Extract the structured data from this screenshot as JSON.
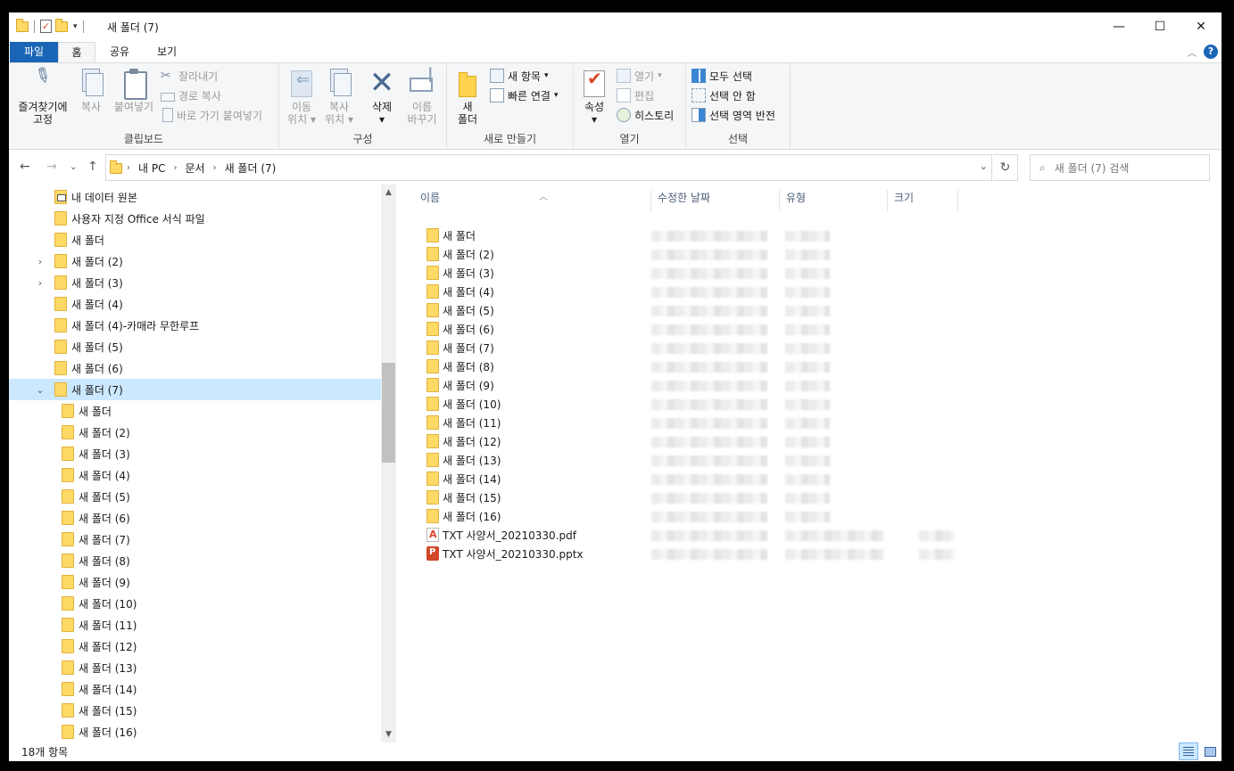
{
  "window": {
    "title": "새 폴더 (7)"
  },
  "tabs": {
    "file": "파일",
    "home": "홈",
    "share": "공유",
    "view": "보기"
  },
  "ribbon": {
    "clipboard": {
      "label": "클립보드",
      "pin_l1": "즐겨찾기에",
      "pin_l2": "고정",
      "copy": "복사",
      "paste": "붙여넣기",
      "cut": "잘라내기",
      "copy_path": "경로 복사",
      "paste_shortcut": "바로 가기 붙여넣기"
    },
    "organize": {
      "label": "구성",
      "move_l1": "이동",
      "move_l2": "위치",
      "copy_l1": "복사",
      "copy_l2": "위치",
      "delete": "삭제",
      "rename_l1": "이름",
      "rename_l2": "바꾸기"
    },
    "new": {
      "label": "새로 만들기",
      "folder_l1": "새",
      "folder_l2": "폴더",
      "new_item": "새 항목",
      "easy_access": "빠른 연결"
    },
    "open": {
      "label": "열기",
      "properties": "속성",
      "open": "열기",
      "edit": "편집",
      "history": "히스토리"
    },
    "select": {
      "label": "선택",
      "select_all": "모두 선택",
      "select_none": "선택 안 함",
      "invert": "선택 영역 반전"
    }
  },
  "address": {
    "crumbs": [
      "내 PC",
      "문서",
      "새 폴더 (7)"
    ],
    "search_placeholder": "새 폴더 (7) 검색"
  },
  "nav_tree": [
    {
      "label": "내 데이터 원본",
      "level": 0,
      "expander": "",
      "special": true
    },
    {
      "label": "사용자 지정 Office 서식 파일",
      "level": 0,
      "expander": ""
    },
    {
      "label": "새 폴더",
      "level": 0,
      "expander": ""
    },
    {
      "label": "새 폴더 (2)",
      "level": 0,
      "expander": "›"
    },
    {
      "label": "새 폴더 (3)",
      "level": 0,
      "expander": "›"
    },
    {
      "label": "새 폴더 (4)",
      "level": 0,
      "expander": ""
    },
    {
      "label": "새 폴더 (4)-카매라 무한루프",
      "level": 0,
      "expander": ""
    },
    {
      "label": "새 폴더 (5)",
      "level": 0,
      "expander": ""
    },
    {
      "label": "새 폴더 (6)",
      "level": 0,
      "expander": ""
    },
    {
      "label": "새 폴더 (7)",
      "level": 0,
      "expander": "⌄",
      "selected": true
    },
    {
      "label": "새 폴더",
      "level": 1,
      "expander": ""
    },
    {
      "label": "새 폴더 (2)",
      "level": 1,
      "expander": ""
    },
    {
      "label": "새 폴더 (3)",
      "level": 1,
      "expander": ""
    },
    {
      "label": "새 폴더 (4)",
      "level": 1,
      "expander": ""
    },
    {
      "label": "새 폴더 (5)",
      "level": 1,
      "expander": ""
    },
    {
      "label": "새 폴더 (6)",
      "level": 1,
      "expander": ""
    },
    {
      "label": "새 폴더 (7)",
      "level": 1,
      "expander": ""
    },
    {
      "label": "새 폴더 (8)",
      "level": 1,
      "expander": ""
    },
    {
      "label": "새 폴더 (9)",
      "level": 1,
      "expander": ""
    },
    {
      "label": "새 폴더 (10)",
      "level": 1,
      "expander": ""
    },
    {
      "label": "새 폴더 (11)",
      "level": 1,
      "expander": ""
    },
    {
      "label": "새 폴더 (12)",
      "level": 1,
      "expander": ""
    },
    {
      "label": "새 폴더 (13)",
      "level": 1,
      "expander": ""
    },
    {
      "label": "새 폴더 (14)",
      "level": 1,
      "expander": ""
    },
    {
      "label": "새 폴더 (15)",
      "level": 1,
      "expander": ""
    },
    {
      "label": "새 폴더 (16)",
      "level": 1,
      "expander": ""
    }
  ],
  "columns": {
    "name": "이름",
    "date": "수정한 날짜",
    "type": "유형",
    "size": "크기"
  },
  "files": [
    {
      "name": "새 폴더",
      "kind": "folder"
    },
    {
      "name": "새 폴더 (2)",
      "kind": "folder"
    },
    {
      "name": "새 폴더 (3)",
      "kind": "folder"
    },
    {
      "name": "새 폴더 (4)",
      "kind": "folder"
    },
    {
      "name": "새 폴더 (5)",
      "kind": "folder"
    },
    {
      "name": "새 폴더 (6)",
      "kind": "folder"
    },
    {
      "name": "새 폴더 (7)",
      "kind": "folder"
    },
    {
      "name": "새 폴더 (8)",
      "kind": "folder"
    },
    {
      "name": "새 폴더 (9)",
      "kind": "folder"
    },
    {
      "name": "새 폴더 (10)",
      "kind": "folder"
    },
    {
      "name": "새 폴더 (11)",
      "kind": "folder"
    },
    {
      "name": "새 폴더 (12)",
      "kind": "folder"
    },
    {
      "name": "새 폴더 (13)",
      "kind": "folder"
    },
    {
      "name": "새 폴더 (14)",
      "kind": "folder"
    },
    {
      "name": "새 폴더 (15)",
      "kind": "folder"
    },
    {
      "name": "새 폴더 (16)",
      "kind": "folder"
    },
    {
      "name": "TXT 사양서_20210330.pdf",
      "kind": "pdf"
    },
    {
      "name": "TXT 사양서_20210330.pptx",
      "kind": "pptx"
    }
  ],
  "status": {
    "item_count": "18개 항목"
  },
  "colors": {
    "accent": "#1a65b5",
    "selection": "#cce8ff",
    "folder": "#ffd966"
  },
  "icons": {
    "pin": "pin-icon",
    "copy": "copy-icon",
    "paste": "paste-icon",
    "cut": "scissors-icon",
    "move": "move-to-icon",
    "delete": "delete-x-icon",
    "rename": "rename-icon",
    "new_folder": "new-folder-icon",
    "properties": "properties-check-icon"
  }
}
